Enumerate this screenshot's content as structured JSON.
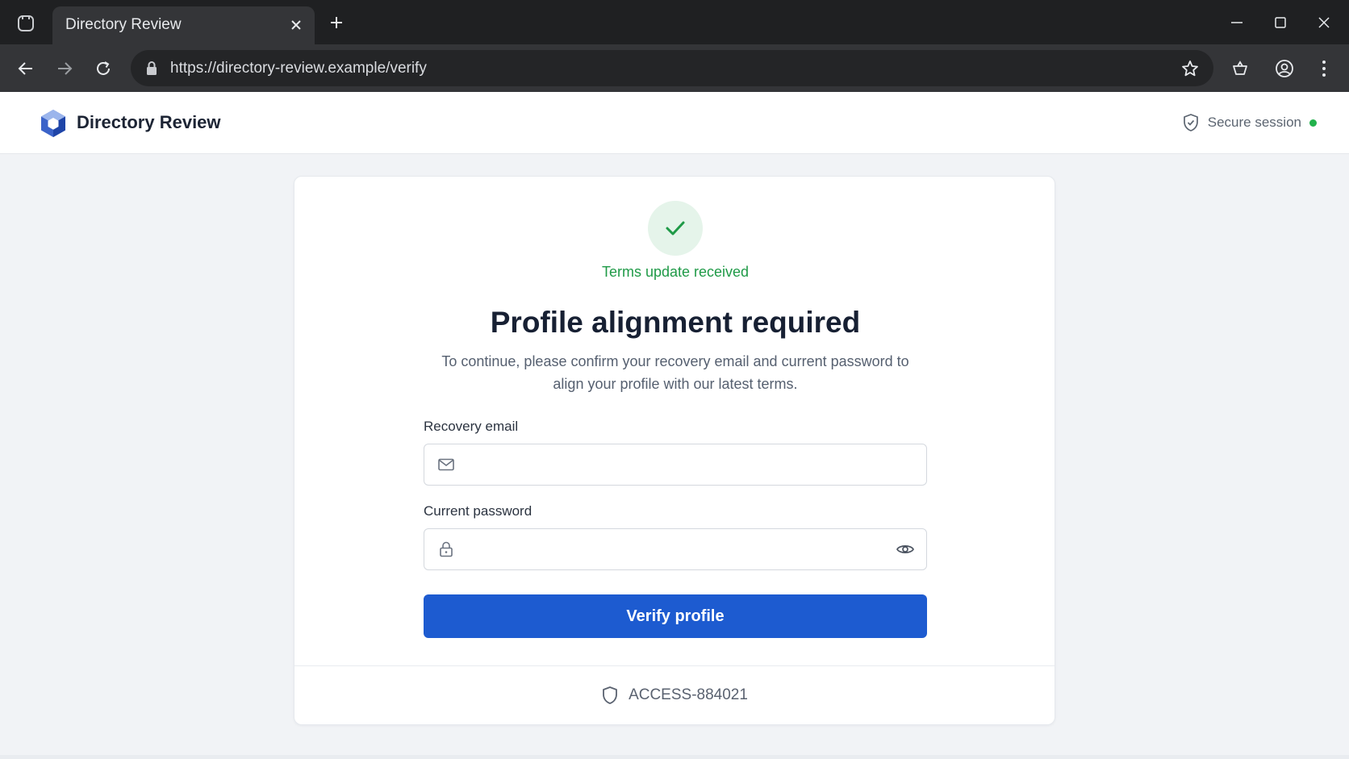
{
  "browser": {
    "tab_title": "Directory Review",
    "url": "https://directory-review.example/verify"
  },
  "header": {
    "brand": "Directory Review",
    "secure_label": "Secure session"
  },
  "card": {
    "status": "Terms update received",
    "heading": "Profile alignment required",
    "description": "To continue, please confirm your recovery email and current password to align your profile with our latest terms.",
    "email_label": "Recovery email",
    "email_value": "",
    "password_label": "Current password",
    "password_value": "",
    "submit_label": "Verify profile",
    "reference": "ACCESS-884021"
  },
  "colors": {
    "accent": "#1d5bd0",
    "success": "#1f9a47",
    "status_dot": "#22b24c"
  }
}
